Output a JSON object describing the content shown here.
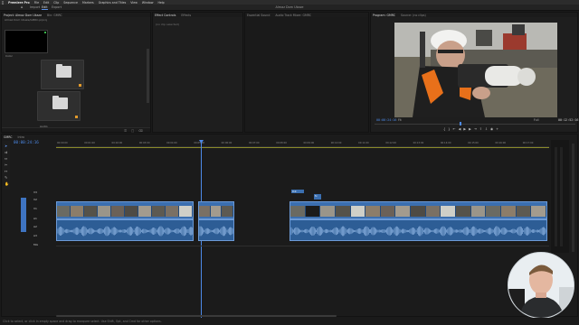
{
  "menubar": {
    "app_name": "Premiere Pro",
    "items": [
      "File",
      "Edit",
      "Clip",
      "Sequence",
      "Markers",
      "Graphics and Titles",
      "View",
      "Window",
      "Help"
    ]
  },
  "workspace": {
    "tabs": [
      "Import",
      "Edit",
      "Export"
    ],
    "active_tab": "Edit",
    "title": "Almaz Dom Ukaze"
  },
  "project_panel": {
    "tab_label": "Project: Almaz Dom Ukaze",
    "tab2_label": "Bin: GMRC",
    "path": "Almaz Dom Ukaze/GMRC.prproj",
    "items_count": "4 Items",
    "thumbnail_label": "Color",
    "bins": [
      {
        "label": "Video",
        "dot_color": "#e29a2b"
      },
      {
        "label": "Audio",
        "dot_color": "#e29a2b"
      }
    ]
  },
  "effect_controls": {
    "tabs": [
      "Effect Controls",
      "Effects",
      "Essential Sound",
      "Audio Track Mixer: GMRC"
    ],
    "placeholder": "(no clip selected)"
  },
  "program_monitor": {
    "tabs": [
      "Program: GMRC",
      "Source: (no clips)"
    ],
    "timecode_left": "00:00:24:16",
    "fit": "Fit",
    "quality": "Full",
    "timecode_right": "00:12:52:16"
  },
  "timeline": {
    "tabs": [
      "GMRC",
      "Intro"
    ],
    "timecode": "00:00:24:16",
    "ruler": [
      "00:00:00",
      "00:01:00",
      "00:02:00",
      "00:03:00",
      "00:04:00",
      "00:05:00",
      "00:06:00",
      "00:07:00",
      "00:08:00",
      "00:09:00",
      "00:10:00",
      "00:11:00",
      "00:12:00",
      "00:13:00",
      "00:14:00",
      "00:15:00",
      "00:16:00",
      "00:17:00"
    ],
    "video_tracks": [
      "V3",
      "V2",
      "V1"
    ],
    "audio_tracks": [
      "A1",
      "A2",
      "A3",
      "Mix"
    ],
    "overlay_labels": [
      "0.0",
      "fx"
    ]
  },
  "status": {
    "text": "Click to select, or click in empty space and drag to marquee select. Use Shift, Opt, and Cmd for other options."
  },
  "colors": {
    "accent": "#5b8fe5",
    "clip": "#3b6fb0",
    "label_orange": "#e29a2b"
  }
}
